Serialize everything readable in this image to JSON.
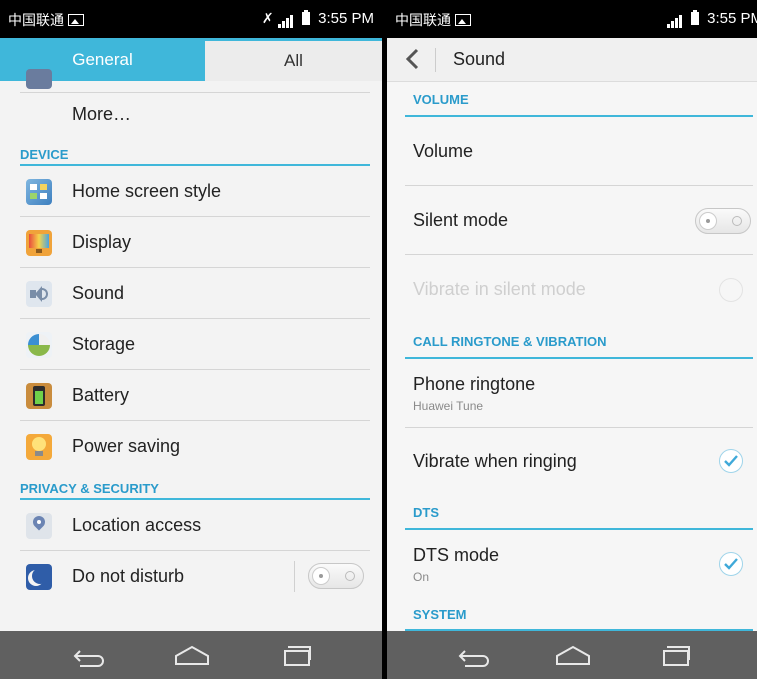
{
  "left": {
    "status": {
      "carrier": "中国联通",
      "time": "3:55 PM"
    },
    "tabs": {
      "general": "General",
      "all": "All"
    },
    "more_label": "More…",
    "sections": {
      "device": "DEVICE",
      "privacy": "PRIVACY & SECURITY"
    },
    "items": [
      {
        "label": "Home screen style",
        "icon": "home-screen-style-icon"
      },
      {
        "label": "Display",
        "icon": "display-icon"
      },
      {
        "label": "Sound",
        "icon": "sound-icon"
      },
      {
        "label": "Storage",
        "icon": "storage-icon"
      },
      {
        "label": "Battery",
        "icon": "battery-icon"
      },
      {
        "label": "Power saving",
        "icon": "power-saving-icon"
      }
    ],
    "privacy_items": [
      {
        "label": "Location access",
        "icon": "location-icon"
      },
      {
        "label": "Do not disturb",
        "icon": "moon-icon",
        "toggle_on": false
      }
    ]
  },
  "right": {
    "status": {
      "carrier": "中国联通",
      "time": "3:55 PM"
    },
    "title": "Sound",
    "sections": {
      "volume": "VOLUME",
      "ringtone": "CALL RINGTONE & VIBRATION",
      "dts": "DTS",
      "system": "SYSTEM"
    },
    "volume_label": "Volume",
    "silent_mode": {
      "label": "Silent mode",
      "on": false
    },
    "vibrate_silent": {
      "label": "Vibrate in silent mode",
      "enabled": false
    },
    "phone_ringtone": {
      "label": "Phone ringtone",
      "value": "Huawei Tune"
    },
    "vibrate_ringing": {
      "label": "Vibrate when ringing",
      "checked": true
    },
    "dts_mode": {
      "label": "DTS mode",
      "value": "On",
      "checked": true
    }
  },
  "colors": {
    "accent": "#3fb7da",
    "section_text": "#2a9bcb",
    "navbar": "#606060"
  }
}
